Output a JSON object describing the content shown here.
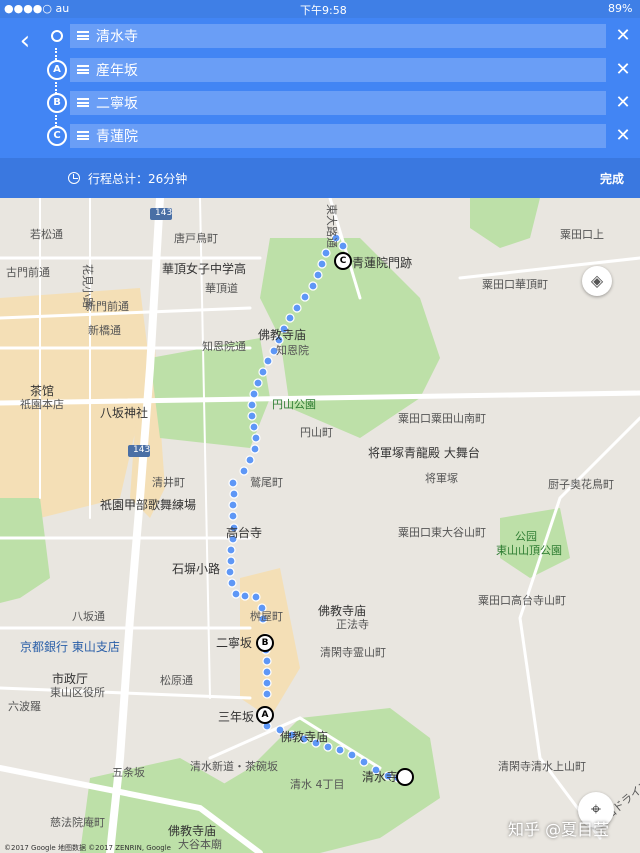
{
  "status_bar": {
    "carrier": "●●●●○ au",
    "time": "下午9:58",
    "battery": "89%"
  },
  "route": {
    "stops": [
      {
        "marker": "",
        "label": "清水寺"
      },
      {
        "marker": "A",
        "label": "産年坂"
      },
      {
        "marker": "B",
        "label": "二寧坂"
      },
      {
        "marker": "C",
        "label": "青蓮院"
      }
    ],
    "total_label": "行程总计：26分钟",
    "done_label": "完成"
  },
  "map": {
    "labels": {
      "wakamiya": "若松通",
      "korobe": "唐戸鳥町",
      "furumonzen": "古門前通",
      "karasuma": "華頂女子中学高",
      "kachoudori": "華頂道",
      "shinmonzen": "新門前通",
      "shinbashi": "新橋通",
      "chion": "知恩院通",
      "bukkyou1": "佛教寺庙",
      "chion_in": "知恩院",
      "chakan": "茶馆",
      "gion_honten": "祇園本店",
      "yasaka_jinja": "八坂神社",
      "maruyama": "円山公園",
      "maruyama_cho": "円山町",
      "awata_kacho": "粟田口華頂町",
      "awata_kami": "粟田口粟田山南町",
      "shogunzuka_seiryuden": "将軍塚青龍殿 大舞台",
      "shogunzuka": "将軍塚",
      "kiyoi": "清井町",
      "washio": "鷲尾町",
      "gion_kobu": "祇園甲部歌舞練場",
      "kodaiji": "高台寺",
      "awata_higashi": "粟田口東大谷山町",
      "ishibe": "石塀小路",
      "koen": "公园",
      "higashiyama_sancho": "東山山頂公園",
      "zushi_okuhanatorii": "厨子奥花鳥町",
      "awata_takadai": "粟田口高台寺山町",
      "yasaka_dori": "八坂通",
      "bank": "京都銀行 東山支店",
      "masuya": "桝屋町",
      "bukkyou2": "佛教寺庙",
      "shouhou": "正法寺",
      "ninenzaka": "二寧坂",
      "shiseido": "市政厅",
      "higashiyama_ward": "東山区役所",
      "matsubara": "松原通",
      "kiyokan": "清閑寺霊山町",
      "rokuhara": "六波羅",
      "sannenzaka": "三年坂",
      "bukkyou3": "佛教寺庙",
      "kiyomizu_shindo": "清水新道・茶碗坂",
      "kiyomizu4": "清水 4丁目",
      "kiyomizudera": "清水寺",
      "gojozaka": "五条坂",
      "jikei": "慈法院庵町",
      "bukkyou4": "佛教寺庙",
      "otani": "大谷本廟",
      "kiyokan2": "清閑寺清水上山町",
      "awata_shrine_label": "粟田口上",
      "route143a": "143",
      "route143b": "143",
      "seiren_in": "青蓮院門跡",
      "kawabata": "花見小路",
      "higashiyama_road": "東大路通",
      "kyoto_driveway": "東山ドライブウェイ"
    },
    "watermark": "知乎 @夏目莹",
    "copyright": "©2017 Google 地图数据 ©2017 ZENRIN, Google",
    "colors": {
      "route": "#5e97f6",
      "park": "#bde0a8",
      "commercial": "#f4dfb6",
      "road": "#ffffff"
    }
  }
}
